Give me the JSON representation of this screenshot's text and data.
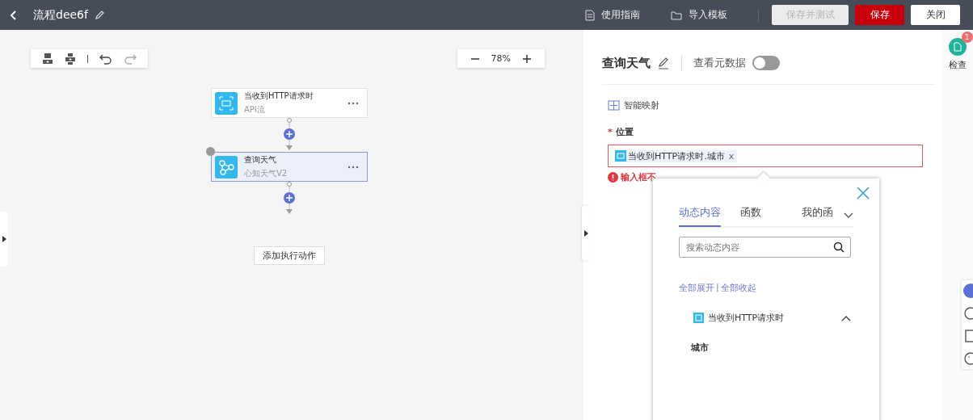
{
  "header": {
    "title": "流程dee6f",
    "links": [
      {
        "label": "使用指南",
        "kind": "doc"
      },
      {
        "label": "导入模板",
        "kind": "folder"
      }
    ],
    "buttons": [
      {
        "label": "保存并测试",
        "kind": "disabled"
      },
      {
        "label": "保存",
        "kind": "primary"
      },
      {
        "label": "关闭",
        "kind": "default"
      }
    ]
  },
  "canvas": {
    "zoom": "78%",
    "nodes": [
      {
        "title": "当收到HTTP请求时",
        "subtitle": "API流",
        "kind": "trigger",
        "selected": false,
        "warning": false
      },
      {
        "title": "查询天气",
        "subtitle": "心知天气V2",
        "kind": "action",
        "selected": true,
        "warning": true
      }
    ],
    "add_button": "添加执行动作"
  },
  "panel": {
    "title": "查询天气",
    "metadata_label": "查看元数据",
    "metadata_on": false,
    "smart_mapping": "智能映射",
    "field": {
      "label": "位置",
      "required": true,
      "required_mark": "*",
      "token": "当收到HTTP请求时.城市",
      "token_remove": "x",
      "error": "输入框不"
    }
  },
  "popup": {
    "tabs": [
      {
        "label": "动态内容",
        "selected": true
      },
      {
        "label": "函数",
        "selected": false
      },
      {
        "label": "我的函",
        "selected": false
      }
    ],
    "search_placeholder": "搜索动态内容",
    "expand_all": "全部展开",
    "separator": "|",
    "collapse_all": "全部收起",
    "groups": [
      {
        "title": "当收到HTTP请求时",
        "expanded": true,
        "children": [
          {
            "label": "城市"
          }
        ]
      }
    ]
  },
  "check": {
    "label": "检查",
    "badge": "1"
  }
}
